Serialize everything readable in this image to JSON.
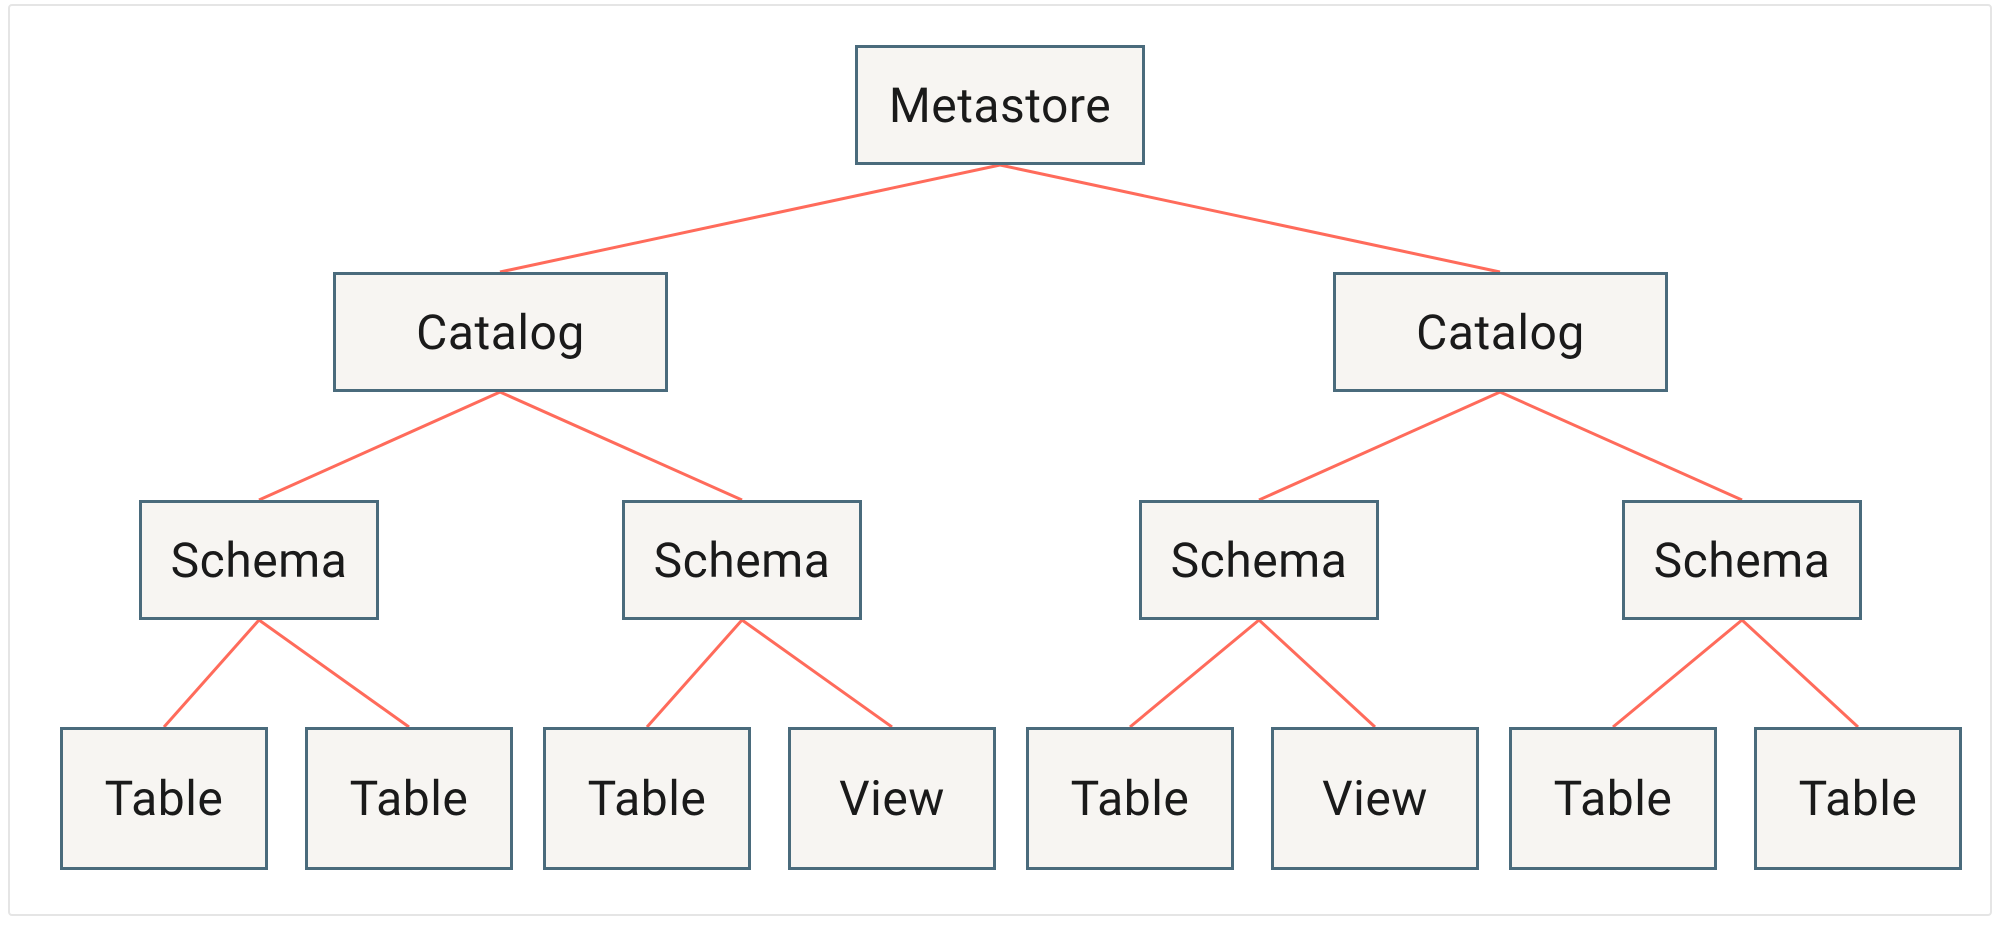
{
  "diagram": {
    "root": {
      "label": "Metastore"
    },
    "level1": [
      {
        "label": "Catalog"
      },
      {
        "label": "Catalog"
      }
    ],
    "level2": [
      {
        "label": "Schema"
      },
      {
        "label": "Schema"
      },
      {
        "label": "Schema"
      },
      {
        "label": "Schema"
      }
    ],
    "level3": [
      {
        "label": "Table"
      },
      {
        "label": "Table"
      },
      {
        "label": "Table"
      },
      {
        "label": "View"
      },
      {
        "label": "Table"
      },
      {
        "label": "View"
      },
      {
        "label": "Table"
      },
      {
        "label": "Table"
      }
    ]
  },
  "colors": {
    "node_fill": "#f7f5f2",
    "node_border": "#4a6b7c",
    "connector": "#ff6b5b",
    "text": "#1a1a1a"
  }
}
